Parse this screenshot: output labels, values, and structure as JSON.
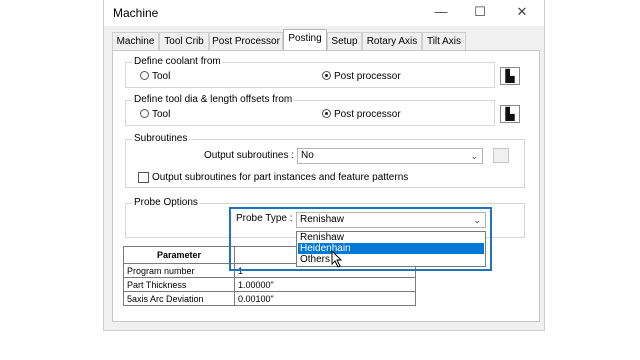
{
  "window": {
    "title": "Machine",
    "min_glyph": "—",
    "max_glyph": "☐",
    "close_glyph": "✕"
  },
  "tabs": [
    {
      "label": "Machine"
    },
    {
      "label": "Tool Crib"
    },
    {
      "label": "Post Processor"
    },
    {
      "label": "Posting"
    },
    {
      "label": "Setup"
    },
    {
      "label": "Rotary Axis"
    },
    {
      "label": "Tilt Axis"
    }
  ],
  "active_tab": "Posting",
  "coolant": {
    "title": "Define coolant from",
    "opt_tool": "Tool",
    "opt_post": "Post processor",
    "selected": "Post processor"
  },
  "offsets": {
    "title": "Define tool dia & length offsets from",
    "opt_tool": "Tool",
    "opt_post": "Post processor",
    "selected": "Post processor"
  },
  "subroutines": {
    "title": "Subroutines",
    "output_label": "Output subroutines :",
    "output_value": "No",
    "checkbox_label": "Output subroutines for part instances and feature patterns",
    "checked": false
  },
  "probe": {
    "title": "Probe Options",
    "type_label": "Probe Type :",
    "type_value": "Renishaw",
    "options": [
      "Renishaw",
      "Heidenhain",
      "Others"
    ],
    "highlighted": "Heidenhain"
  },
  "params": {
    "header_param": "Parameter",
    "header_value": "",
    "rows": [
      {
        "name": "Program number",
        "value": "1"
      },
      {
        "name": "Part Thickness",
        "value": "1.00000\""
      },
      {
        "name": "5axis Arc Deviation",
        "value": "0.00100\""
      }
    ]
  },
  "icon_glyph": "▙"
}
